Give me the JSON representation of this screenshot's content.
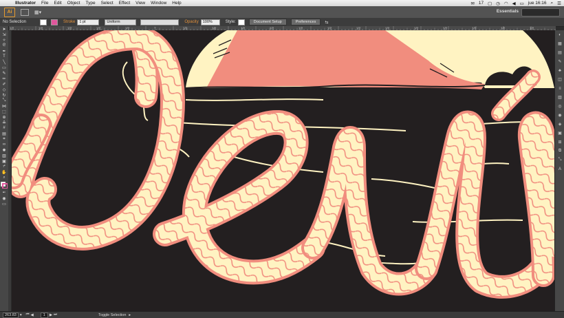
{
  "menubar": {
    "apple_glyph": "",
    "app_name": "Illustrator",
    "menus": [
      "File",
      "Edit",
      "Object",
      "Type",
      "Select",
      "Effect",
      "View",
      "Window",
      "Help"
    ],
    "status_num": "17",
    "clock": "jue 16:16"
  },
  "appbar": {
    "logo": "Ai",
    "workspace_label": "Essentials",
    "workspace_switch_glyph": "▦▾"
  },
  "control": {
    "selection": "No Selection",
    "stroke_label": "Stroke",
    "stroke_weight": "1 pt",
    "stroke_style": "Uniform",
    "opacity_label": "Opacity",
    "opacity_value": "100%",
    "style_label": "Style:",
    "document_setup": "Document Setup",
    "preferences": "Preferences"
  },
  "colors": {
    "canvas": "#231f20",
    "rope_fill": "#fff3c2",
    "rope_outline": "#f18d7e",
    "cream": "#fff3c2",
    "salmon": "#f18d7e"
  },
  "status": {
    "zoom": "263.83",
    "page": "1",
    "message": "Toggle Selection"
  },
  "ruler_ticks": [
    "1/2",
    "1/2",
    "1/2",
    "1/2",
    "1/2",
    "7",
    "1/2",
    "1/2",
    "1/2",
    "1/2",
    "1/2",
    "1/2",
    "1/2",
    "1/2",
    "1/2",
    "1/2",
    "1/2",
    "1/2",
    "1/2"
  ]
}
